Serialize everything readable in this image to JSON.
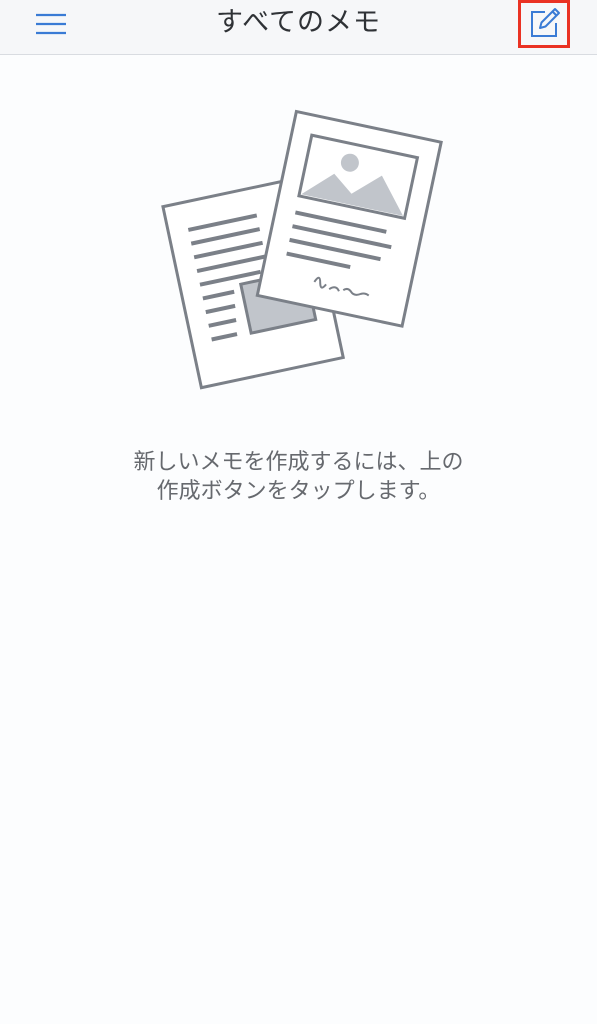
{
  "navbar": {
    "title": "すべてのメモ",
    "menu_icon": "hamburger-menu-icon",
    "compose_icon": "compose-edit-icon"
  },
  "empty_state": {
    "illustration": "documents-illustration",
    "line1": "新しいメモを作成するには、上の",
    "line2": "作成ボタンをタップします。"
  },
  "colors": {
    "accent": "#3a7bd5",
    "highlight": "#ea3223",
    "illustration_stroke": "#7b8088",
    "illustration_fill": "#c1c5cb"
  }
}
